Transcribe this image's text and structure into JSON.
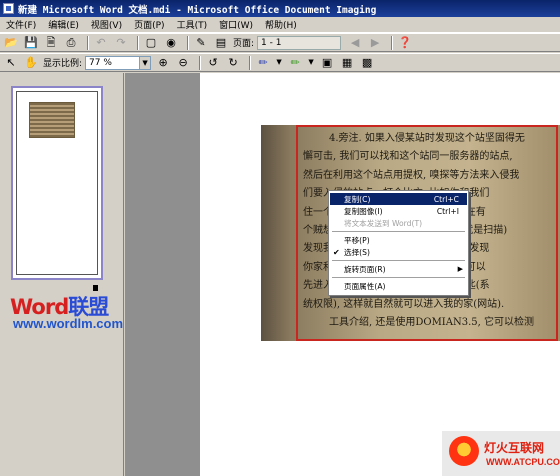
{
  "window": {
    "title": "新建 Microsoft Word 文档.mdi - Microsoft Office Document Imaging"
  },
  "menubar": [
    "文件(F)",
    "编辑(E)",
    "视图(V)",
    "页面(P)",
    "工具(T)",
    "窗口(W)",
    "帮助(H)"
  ],
  "toolbar": {
    "page_label": "页面:",
    "page_value": "1 - 1",
    "zoom_label": "显示比例:",
    "zoom_value": "77 %",
    "icons": [
      "open-icon",
      "save-icon",
      "print-preview-icon",
      "print-icon",
      "undo-icon",
      "redo-icon",
      "select-icon",
      "find-icon",
      "send-to-word-icon",
      "reading-view-icon",
      "prev-page-icon",
      "next-page-icon",
      "help-icon",
      "pointer-icon",
      "hand-icon",
      "zoom-in-icon",
      "zoom-out-icon",
      "rotate-left-icon",
      "rotate-right-icon",
      "pen-icon",
      "highlighter-icon",
      "text-box-icon",
      "picture-icon",
      "annotation-icon"
    ]
  },
  "document": {
    "lines": [
      "4.旁注. 如果入侵某站时发现这个站坚固得无",
      "懈可击, 我们可以找和这个站同一服务器的站点,",
      "然后在利用这个站点用提权, 嗅探等方法来入侵我",
      "们要入侵的站点。打个比方, 比如你和我们",
      "住一个小区, 我们家里的门户百出, 现在有",
      "个贼想来我们家偷东西, 在我们家(也就是扫描)",
      "发现我们家的门户百出, 于是这个贼却发现",
      "你家和我家在同一个小区, 就去了. 他可以",
      "先进入你家里, 拿到钥匙, 得到楼的钥匙(系",
      "统权限), 这样就自然就可以进入我的家(网站).",
      "工具介绍, 还是使用DOMIAN3.5, 它可以检测"
    ]
  },
  "context_menu": {
    "items": [
      {
        "label": "复制(C)",
        "shortcut": "Ctrl+C",
        "highlighted": true
      },
      {
        "label": "复制图像(I)",
        "shortcut": "Ctrl+I"
      },
      {
        "label": "将文本发送到 Word(T)",
        "disabled": true
      },
      {
        "label": "平移(P)"
      },
      {
        "label": "选择(S)",
        "checked": true
      },
      {
        "label": "旋转页面(R)",
        "submenu": true
      },
      {
        "label": "页面属性(A)"
      }
    ]
  },
  "branding": {
    "logo_word": "Word",
    "logo_cn": "联盟",
    "logo_url": "www.wordlm.com",
    "watermark_cn": "灯火互联网",
    "watermark_url": "WWW.ATCPU.COM"
  }
}
